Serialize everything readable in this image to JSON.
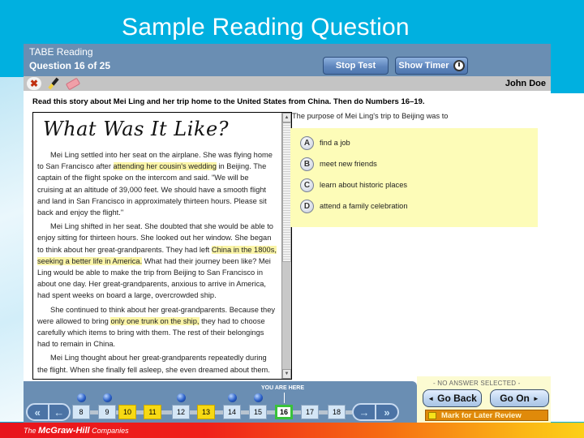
{
  "slide": {
    "title": "Sample Reading Question",
    "footer_brand_prefix": "The",
    "footer_brand_name": "McGraw-Hill",
    "footer_brand_suffix": "Companies"
  },
  "header": {
    "test_name": "TABE Reading",
    "question_counter": "Question 16  of  25",
    "stop_test_label": "Stop Test",
    "show_timer_label": "Show Timer"
  },
  "toolbar": {
    "tools": [
      {
        "name": "eliminate",
        "icon": "x-mark-icon"
      },
      {
        "name": "highlighter",
        "icon": "highlighter-icon"
      },
      {
        "name": "eraser",
        "icon": "eraser-icon"
      }
    ],
    "username": "John  Doe"
  },
  "instructions": "Read this story about Mei Ling and her trip home to the United States from China. Then do Numbers 16–19.",
  "passage": {
    "title": "What Was It Like?",
    "paragraphs": [
      {
        "pre": "Mei Ling settled into her seat on the airplane. She was flying home to San Francisco after ",
        "hl": "attending her cousin's wedding",
        "post": " in Beijing. The captain of the flight spoke on the intercom and said. \"We will be cruising at an altitude of 39,000 feet. We should have a smooth flight and land in San Francisco in approximately thirteen hours. Please sit back and enjoy the flight.\""
      },
      {
        "pre": "Mei Ling shifted in her seat. She doubted that she would be able to enjoy sitting for thirteen hours. She looked out her window. She began to think about her great-grandparents. They had left ",
        "hl": "China in the 1800s, seeking a better life in America.",
        "post": " What had their journey been like? Mei Ling would be able to make the trip from Beijing to San Francisco in about one day. Her great-grandparents, anxious to arrive in America, had spent weeks on board a large, overcrowded ship."
      },
      {
        "pre": "She continued to think about her great-grandparents. Because they were allowed to bring ",
        "hl": "only one trunk on the ship,",
        "post": " they had to choose carefully which items to bring with them. The rest of their belongings had to remain in China."
      },
      {
        "pre": "Mei Ling thought about her great-grandparents repeatedly during the flight. When she finally fell asleep, she even dreamed about them.",
        "hl": "",
        "post": ""
      }
    ],
    "scroll_up": "▲",
    "scroll_down": "▼"
  },
  "question": {
    "stem": "The purpose of Mei Ling's trip to Beijing was to",
    "options": [
      {
        "letter": "A",
        "text": "find a job"
      },
      {
        "letter": "B",
        "text": "meet new friends"
      },
      {
        "letter": "C",
        "text": "learn about historic places"
      },
      {
        "letter": "D",
        "text": "attend a family celebration"
      }
    ]
  },
  "navigation": {
    "you_are_here": "YOU ARE HERE",
    "first_icon": "«",
    "prev_icon": "←",
    "next_icon": "→",
    "last_icon": "»",
    "questions": [
      {
        "num": "8",
        "state": "answered",
        "dot": true
      },
      {
        "num": "9",
        "state": "answered",
        "dot": true
      },
      {
        "num": "10",
        "state": "flagged",
        "dot": false
      },
      {
        "num": "11",
        "state": "flagged",
        "dot": false
      },
      {
        "num": "12",
        "state": "answered",
        "dot": true
      },
      {
        "num": "13",
        "state": "flagged",
        "dot": false
      },
      {
        "num": "14",
        "state": "answered",
        "dot": true
      },
      {
        "num": "15",
        "state": "answered",
        "dot": true
      },
      {
        "num": "16",
        "state": "current",
        "dot": false
      },
      {
        "num": "17",
        "state": "unvisited",
        "dot": false
      },
      {
        "num": "18",
        "state": "unvisited",
        "dot": false
      }
    ],
    "status": "- NO ANSWER SELECTED -",
    "go_back_label": "Go Back",
    "go_on_label": "Go On",
    "back_arrow": "◄",
    "on_arrow": "►",
    "mark_review_label": "Mark for Later Review",
    "colors": {
      "flagged": "#f7d913",
      "current_border": "#39c23a",
      "answered": "#d4e6f6"
    }
  }
}
